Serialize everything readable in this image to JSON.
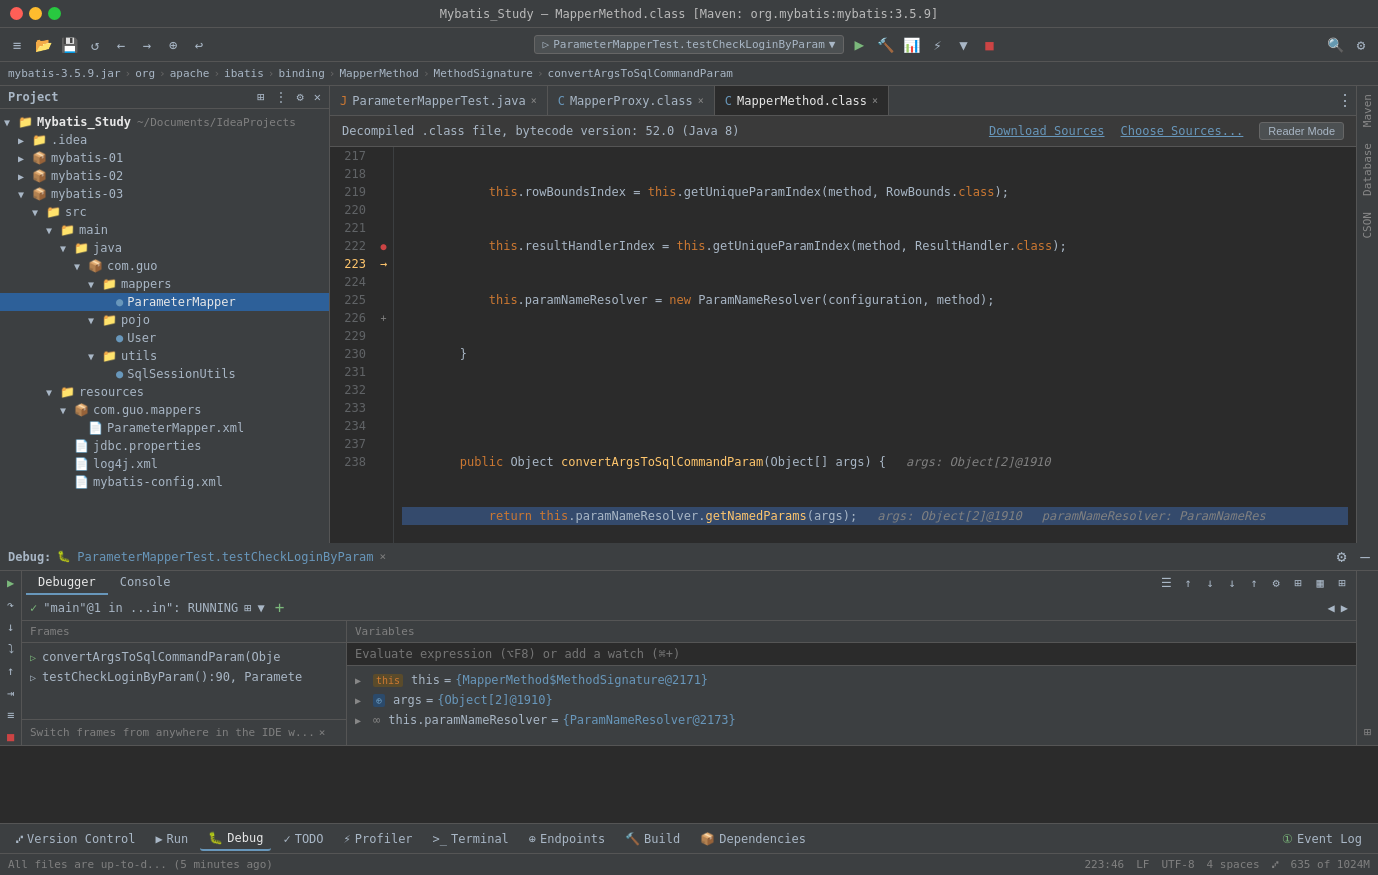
{
  "window": {
    "title": "Mybatis_Study – MapperMethod.class [Maven: org.mybatis:mybatis:3.5.9]"
  },
  "toolbar": {
    "run_config": "ParameterMapperTest.testCheckLoginByParam",
    "run_label": "▶",
    "debug_label": "🐛",
    "stop_label": "■"
  },
  "breadcrumb": {
    "items": [
      "mybatis-3.5.9.jar",
      "org",
      "apache",
      "ibatis",
      "binding",
      "MapperMethod",
      "MethodSignature",
      "convertArgsToSqlCommandParam"
    ]
  },
  "tabs": [
    {
      "name": "ParameterMapperTest.java",
      "type": "java",
      "active": false
    },
    {
      "name": "MapperProxy.class",
      "type": "class",
      "active": false
    },
    {
      "name": "MapperMethod.class",
      "type": "class",
      "active": true
    }
  ],
  "decompile_banner": {
    "text": "Decompiled .class file, bytecode version: 52.0 (Java 8)",
    "download_sources": "Download Sources",
    "choose_sources": "Choose Sources...",
    "reader_mode": "Reader Mode"
  },
  "code_lines": [
    {
      "num": "217",
      "content": "            this.rowBoundsIndex = this.getUniqueParamIndex(method, RowBounds.class);",
      "highlight": false
    },
    {
      "num": "218",
      "content": "            this.resultHandlerIndex = this.getUniqueParamIndex(method, ResultHandler.class);",
      "highlight": false
    },
    {
      "num": "219",
      "content": "            this.paramNameResolver = new ParamNameResolver(configuration, method);",
      "highlight": false
    },
    {
      "num": "220",
      "content": "        }",
      "highlight": false
    },
    {
      "num": "221",
      "content": "",
      "highlight": false
    },
    {
      "num": "222",
      "content": "        public Object convertArgsToSqlCommandParam(Object[] args) {    args: Object[2]@1910",
      "highlight": false
    },
    {
      "num": "223",
      "content": "            return this.paramNameResolver.getNamedParams(args);    args: Object[2]@1910    paramNameResolver: ParamNameRes",
      "highlight": true,
      "debug": true
    },
    {
      "num": "224",
      "content": "        }",
      "highlight": false
    },
    {
      "num": "225",
      "content": "",
      "highlight": false
    },
    {
      "num": "226",
      "content": "        public boolean hasRowBounds() { return this.rowBoundsIndex != null; }",
      "highlight": false
    },
    {
      "num": "229",
      "content": "",
      "highlight": false
    },
    {
      "num": "230",
      "content": "        public RowBounds extractRowBounds(Object[] args) {",
      "highlight": false
    },
    {
      "num": "231",
      "content": "            return this.hasRowBounds() ? (RowBounds)args[this.rowBoundsIndex] : null;",
      "highlight": false
    },
    {
      "num": "232",
      "content": "        }",
      "highlight": false
    },
    {
      "num": "233",
      "content": "",
      "highlight": false
    },
    {
      "num": "234",
      "content": "        public boolean hasResultHandler() { return this.resultHandlerIndex != null; }",
      "highlight": false
    },
    {
      "num": "237",
      "content": "",
      "highlight": false
    },
    {
      "num": "238",
      "content": "        public ResultHandler extractResultHandler(Object[] args) {",
      "highlight": false
    }
  ],
  "sidebar": {
    "title": "Project",
    "tree": [
      {
        "label": "Mybatis_Study",
        "indent": 0,
        "type": "project",
        "expanded": true,
        "suffix": "~/Documents/IdeaProjects"
      },
      {
        "label": ".idea",
        "indent": 1,
        "type": "folder",
        "expanded": false
      },
      {
        "label": "mybatis-01",
        "indent": 1,
        "type": "module",
        "expanded": false
      },
      {
        "label": "mybatis-02",
        "indent": 1,
        "type": "module",
        "expanded": false
      },
      {
        "label": "mybatis-03",
        "indent": 1,
        "type": "module",
        "expanded": true
      },
      {
        "label": "src",
        "indent": 2,
        "type": "folder",
        "expanded": true
      },
      {
        "label": "main",
        "indent": 3,
        "type": "folder",
        "expanded": true
      },
      {
        "label": "java",
        "indent": 4,
        "type": "folder",
        "expanded": true
      },
      {
        "label": "com.guo",
        "indent": 5,
        "type": "package",
        "expanded": true
      },
      {
        "label": "mappers",
        "indent": 6,
        "type": "folder",
        "expanded": true
      },
      {
        "label": "ParameterMapper",
        "indent": 7,
        "type": "mapper",
        "selected": true
      },
      {
        "label": "pojo",
        "indent": 6,
        "type": "folder",
        "expanded": true
      },
      {
        "label": "User",
        "indent": 7,
        "type": "class"
      },
      {
        "label": "utils",
        "indent": 6,
        "type": "folder",
        "expanded": true
      },
      {
        "label": "SqlSessionUtils",
        "indent": 7,
        "type": "class"
      },
      {
        "label": "resources",
        "indent": 3,
        "type": "folder",
        "expanded": true
      },
      {
        "label": "com.guo.mappers",
        "indent": 4,
        "type": "package",
        "expanded": true
      },
      {
        "label": "ParameterMapper.xml",
        "indent": 5,
        "type": "xml"
      },
      {
        "label": "jdbc.properties",
        "indent": 4,
        "type": "props"
      },
      {
        "label": "log4j.xml",
        "indent": 4,
        "type": "xml"
      },
      {
        "label": "mybatis-config.xml",
        "indent": 4,
        "type": "xml"
      }
    ]
  },
  "debug": {
    "title": "Debug:",
    "tab_name": "ParameterMapperTest.testCheckLoginByParam",
    "tabs": [
      "Debugger",
      "Console"
    ],
    "active_tab": "Debugger",
    "frames_header": "Frames",
    "variables_header": "Variables",
    "thread": "\"main\"@1 in ...in\": RUNNING",
    "frames": [
      {
        "label": "convertArgsToSqlCommandParam(Obje",
        "type": "frame"
      },
      {
        "label": "testCheckLoginByParam():90, Paramete",
        "type": "frame"
      }
    ],
    "variables": [
      {
        "name": "this",
        "value": "{MapperMethod$MethodSignature@2171}",
        "icon": "this",
        "expanded": false
      },
      {
        "name": "args",
        "value": "{Object[2]@1910}",
        "icon": "arg",
        "expanded": false
      },
      {
        "name": "this.paramNameResolver",
        "value": "{ParamNameResolver@2173}",
        "icon": "inf",
        "expanded": false
      }
    ],
    "eval_placeholder": "Evaluate expression (⌥F8) or add a watch (⌘+)"
  },
  "bottom_tabs": [
    {
      "label": "Version Control",
      "active": false
    },
    {
      "label": "Run",
      "active": false
    },
    {
      "label": "Debug",
      "active": true
    },
    {
      "label": "TODO",
      "active": false
    },
    {
      "label": "Profiler",
      "active": false
    },
    {
      "label": "Terminal",
      "active": false
    },
    {
      "label": "Endpoints",
      "active": false
    },
    {
      "label": "Build",
      "active": false
    },
    {
      "label": "Dependencies",
      "active": false
    }
  ],
  "status_bar": {
    "left": "All files are up-to-d... (5 minutes ago)",
    "position": "223:46",
    "encoding": "UTF-8",
    "indent": "4 spaces",
    "event_log": "Event Log",
    "lf": "LF"
  },
  "switch_hint": "Switch frames from anywhere in the IDE w...",
  "right_panel_labels": [
    "Maven",
    "Database",
    "CSON"
  ]
}
